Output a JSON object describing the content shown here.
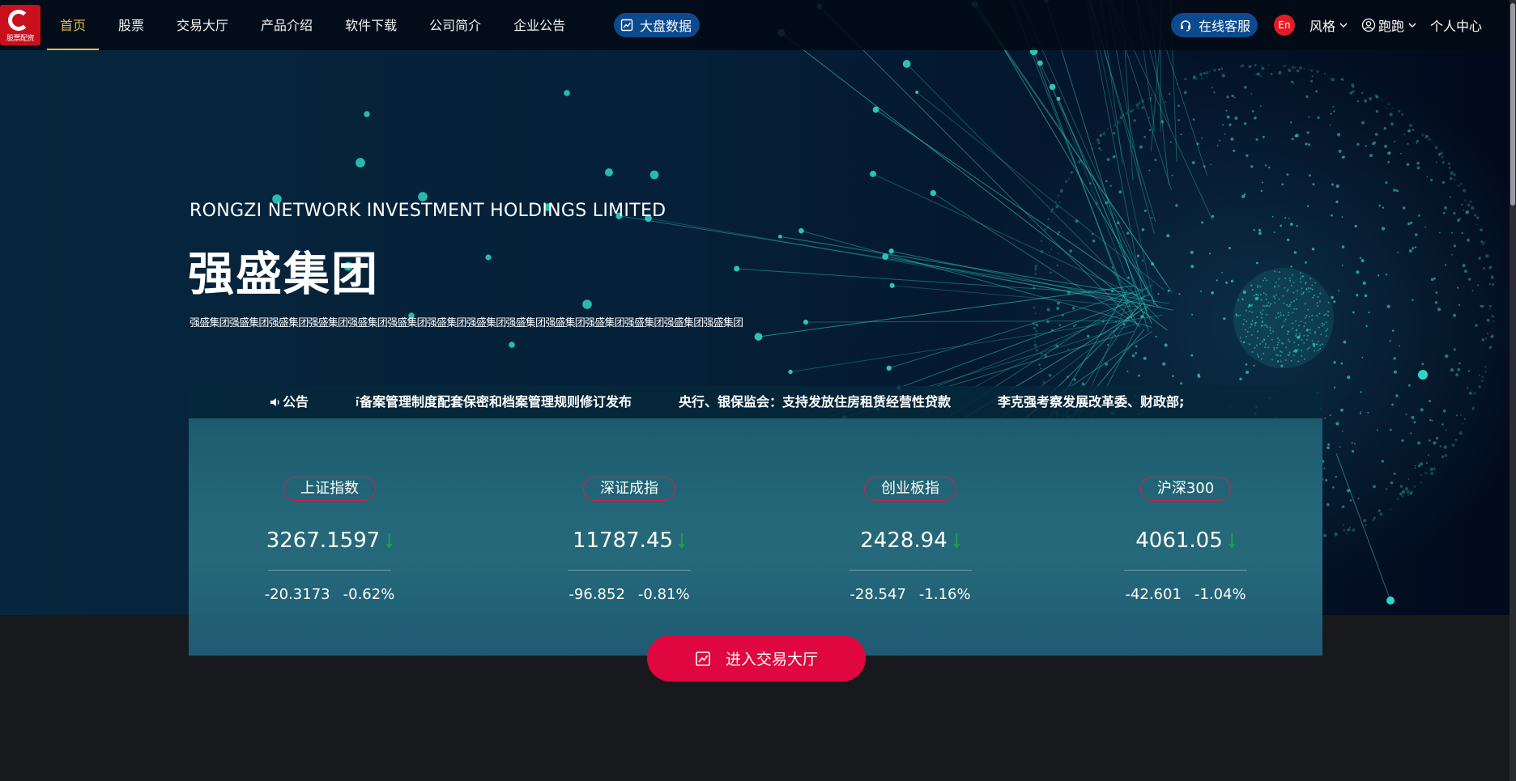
{
  "nav": {
    "logo_text": "股票配资",
    "items": [
      {
        "label": "首页",
        "active": true
      },
      {
        "label": "股票",
        "active": false
      },
      {
        "label": "交易大厅",
        "active": false
      },
      {
        "label": "产品介绍",
        "active": false
      },
      {
        "label": "软件下载",
        "active": false
      },
      {
        "label": "公司简介",
        "active": false
      },
      {
        "label": "企业公告",
        "active": false
      }
    ],
    "big_data_label": "大盘数据",
    "online_service": "在线客服",
    "lang_badge": "En",
    "style_label": "风格",
    "user_name": "跑跑",
    "personal_center": "个人中心"
  },
  "hero": {
    "company_en": "RONGZI NETWORK INVESTMENT HOLDINGS LIMITED",
    "company_cn": "强盛集团",
    "tagline": "强盛集团强盛集团强盛集团强盛集团强盛集团强盛集团强盛集团强盛集团强盛集团强盛集团强盛集团强盛集团强盛集团强盛集团"
  },
  "ticker": {
    "label": "公告",
    "items": [
      "上市备案管理制度配套保密和档案管理规则修订发布",
      "央行、银保监会：支持发放住房租赁经营性贷款",
      "李克强考察发展改革委、财政部;"
    ]
  },
  "indices": [
    {
      "name": "上证指数",
      "value": "3267.1597",
      "change": "-20.3173",
      "percent": "-0.62%"
    },
    {
      "name": "深证成指",
      "value": "11787.45",
      "change": "-96.852",
      "percent": "-0.81%"
    },
    {
      "name": "创业板指",
      "value": "2428.94",
      "change": "-28.547",
      "percent": "-1.16%"
    },
    {
      "name": "沪深300",
      "value": "4061.05",
      "change": "-42.601",
      "percent": "-1.04%"
    }
  ],
  "enter_button": "进入交易大厅",
  "colors": {
    "accent_gold": "#e7b94c",
    "primary_blue": "#0b4a8e",
    "cta_red": "#e0063f",
    "down_green": "#1aa14b",
    "badge_border": "#d21f4e",
    "viz_teal": "#2fd5c4"
  }
}
